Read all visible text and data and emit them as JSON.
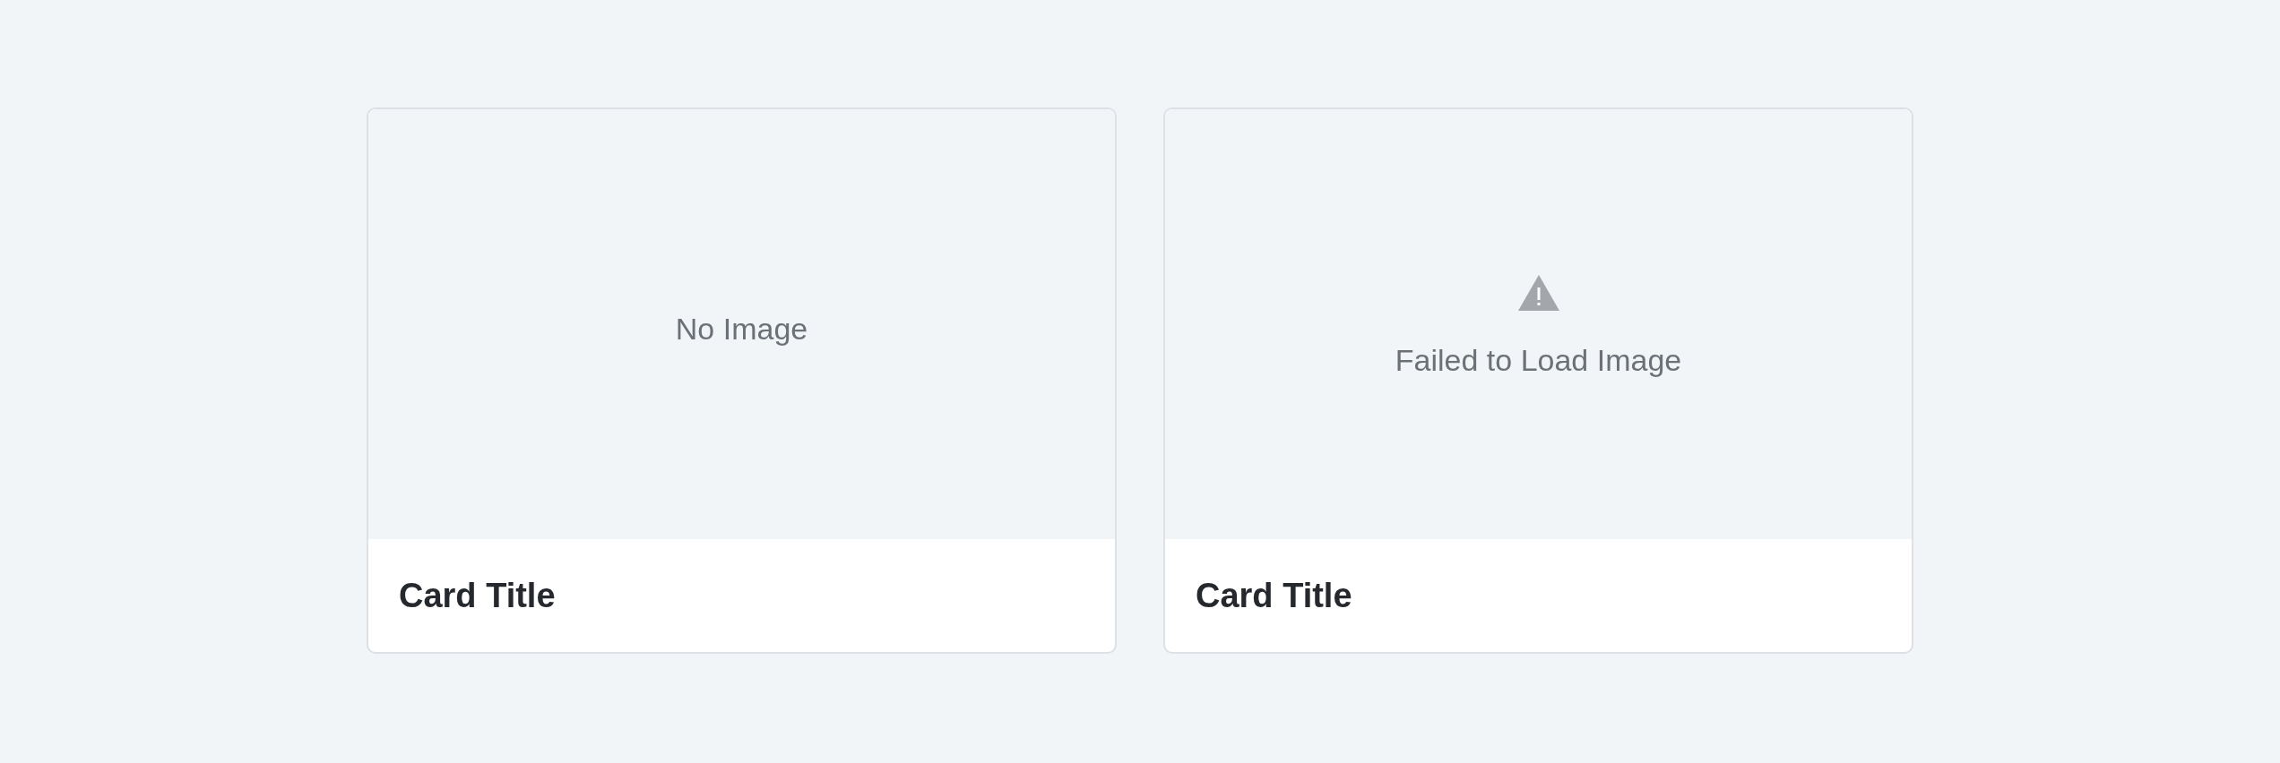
{
  "cards": [
    {
      "image": {
        "kind": "empty",
        "message": "No Image"
      },
      "title": "Card Title"
    },
    {
      "image": {
        "kind": "error",
        "message": "Failed to Load Image"
      },
      "title": "Card Title"
    }
  ]
}
